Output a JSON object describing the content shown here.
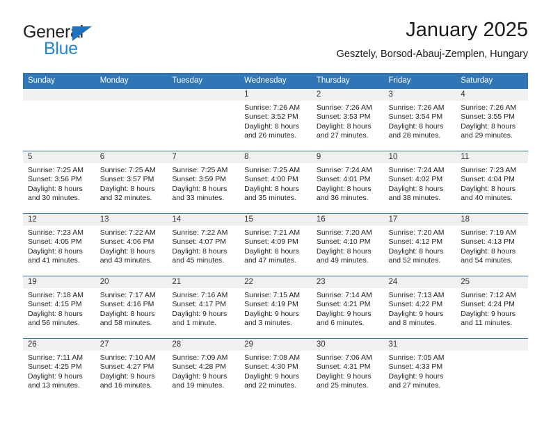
{
  "brand": {
    "name_part1": "General",
    "name_part2": "Blue",
    "triangle_icon": "triangle-icon"
  },
  "header": {
    "title": "January 2025",
    "subtitle": "Gesztely, Borsod-Abauj-Zemplen, Hungary"
  },
  "colors": {
    "header_blue": "#3075b5",
    "brand_blue": "#1f86d6",
    "daynum_band": "#f0f0f0",
    "text": "#222222"
  },
  "calendar": {
    "weekday_headers": [
      "Sunday",
      "Monday",
      "Tuesday",
      "Wednesday",
      "Thursday",
      "Friday",
      "Saturday"
    ],
    "weeks": [
      [
        {
          "day": "",
          "sunrise": "",
          "sunset": "",
          "daylight_line1": "",
          "daylight_line2": ""
        },
        {
          "day": "",
          "sunrise": "",
          "sunset": "",
          "daylight_line1": "",
          "daylight_line2": ""
        },
        {
          "day": "",
          "sunrise": "",
          "sunset": "",
          "daylight_line1": "",
          "daylight_line2": ""
        },
        {
          "day": "1",
          "sunrise": "Sunrise: 7:26 AM",
          "sunset": "Sunset: 3:52 PM",
          "daylight_line1": "Daylight: 8 hours",
          "daylight_line2": "and 26 minutes."
        },
        {
          "day": "2",
          "sunrise": "Sunrise: 7:26 AM",
          "sunset": "Sunset: 3:53 PM",
          "daylight_line1": "Daylight: 8 hours",
          "daylight_line2": "and 27 minutes."
        },
        {
          "day": "3",
          "sunrise": "Sunrise: 7:26 AM",
          "sunset": "Sunset: 3:54 PM",
          "daylight_line1": "Daylight: 8 hours",
          "daylight_line2": "and 28 minutes."
        },
        {
          "day": "4",
          "sunrise": "Sunrise: 7:26 AM",
          "sunset": "Sunset: 3:55 PM",
          "daylight_line1": "Daylight: 8 hours",
          "daylight_line2": "and 29 minutes."
        }
      ],
      [
        {
          "day": "5",
          "sunrise": "Sunrise: 7:25 AM",
          "sunset": "Sunset: 3:56 PM",
          "daylight_line1": "Daylight: 8 hours",
          "daylight_line2": "and 30 minutes."
        },
        {
          "day": "6",
          "sunrise": "Sunrise: 7:25 AM",
          "sunset": "Sunset: 3:57 PM",
          "daylight_line1": "Daylight: 8 hours",
          "daylight_line2": "and 32 minutes."
        },
        {
          "day": "7",
          "sunrise": "Sunrise: 7:25 AM",
          "sunset": "Sunset: 3:59 PM",
          "daylight_line1": "Daylight: 8 hours",
          "daylight_line2": "and 33 minutes."
        },
        {
          "day": "8",
          "sunrise": "Sunrise: 7:25 AM",
          "sunset": "Sunset: 4:00 PM",
          "daylight_line1": "Daylight: 8 hours",
          "daylight_line2": "and 35 minutes."
        },
        {
          "day": "9",
          "sunrise": "Sunrise: 7:24 AM",
          "sunset": "Sunset: 4:01 PM",
          "daylight_line1": "Daylight: 8 hours",
          "daylight_line2": "and 36 minutes."
        },
        {
          "day": "10",
          "sunrise": "Sunrise: 7:24 AM",
          "sunset": "Sunset: 4:02 PM",
          "daylight_line1": "Daylight: 8 hours",
          "daylight_line2": "and 38 minutes."
        },
        {
          "day": "11",
          "sunrise": "Sunrise: 7:23 AM",
          "sunset": "Sunset: 4:04 PM",
          "daylight_line1": "Daylight: 8 hours",
          "daylight_line2": "and 40 minutes."
        }
      ],
      [
        {
          "day": "12",
          "sunrise": "Sunrise: 7:23 AM",
          "sunset": "Sunset: 4:05 PM",
          "daylight_line1": "Daylight: 8 hours",
          "daylight_line2": "and 41 minutes."
        },
        {
          "day": "13",
          "sunrise": "Sunrise: 7:22 AM",
          "sunset": "Sunset: 4:06 PM",
          "daylight_line1": "Daylight: 8 hours",
          "daylight_line2": "and 43 minutes."
        },
        {
          "day": "14",
          "sunrise": "Sunrise: 7:22 AM",
          "sunset": "Sunset: 4:07 PM",
          "daylight_line1": "Daylight: 8 hours",
          "daylight_line2": "and 45 minutes."
        },
        {
          "day": "15",
          "sunrise": "Sunrise: 7:21 AM",
          "sunset": "Sunset: 4:09 PM",
          "daylight_line1": "Daylight: 8 hours",
          "daylight_line2": "and 47 minutes."
        },
        {
          "day": "16",
          "sunrise": "Sunrise: 7:20 AM",
          "sunset": "Sunset: 4:10 PM",
          "daylight_line1": "Daylight: 8 hours",
          "daylight_line2": "and 49 minutes."
        },
        {
          "day": "17",
          "sunrise": "Sunrise: 7:20 AM",
          "sunset": "Sunset: 4:12 PM",
          "daylight_line1": "Daylight: 8 hours",
          "daylight_line2": "and 52 minutes."
        },
        {
          "day": "18",
          "sunrise": "Sunrise: 7:19 AM",
          "sunset": "Sunset: 4:13 PM",
          "daylight_line1": "Daylight: 8 hours",
          "daylight_line2": "and 54 minutes."
        }
      ],
      [
        {
          "day": "19",
          "sunrise": "Sunrise: 7:18 AM",
          "sunset": "Sunset: 4:15 PM",
          "daylight_line1": "Daylight: 8 hours",
          "daylight_line2": "and 56 minutes."
        },
        {
          "day": "20",
          "sunrise": "Sunrise: 7:17 AM",
          "sunset": "Sunset: 4:16 PM",
          "daylight_line1": "Daylight: 8 hours",
          "daylight_line2": "and 58 minutes."
        },
        {
          "day": "21",
          "sunrise": "Sunrise: 7:16 AM",
          "sunset": "Sunset: 4:17 PM",
          "daylight_line1": "Daylight: 9 hours",
          "daylight_line2": "and 1 minute."
        },
        {
          "day": "22",
          "sunrise": "Sunrise: 7:15 AM",
          "sunset": "Sunset: 4:19 PM",
          "daylight_line1": "Daylight: 9 hours",
          "daylight_line2": "and 3 minutes."
        },
        {
          "day": "23",
          "sunrise": "Sunrise: 7:14 AM",
          "sunset": "Sunset: 4:21 PM",
          "daylight_line1": "Daylight: 9 hours",
          "daylight_line2": "and 6 minutes."
        },
        {
          "day": "24",
          "sunrise": "Sunrise: 7:13 AM",
          "sunset": "Sunset: 4:22 PM",
          "daylight_line1": "Daylight: 9 hours",
          "daylight_line2": "and 8 minutes."
        },
        {
          "day": "25",
          "sunrise": "Sunrise: 7:12 AM",
          "sunset": "Sunset: 4:24 PM",
          "daylight_line1": "Daylight: 9 hours",
          "daylight_line2": "and 11 minutes."
        }
      ],
      [
        {
          "day": "26",
          "sunrise": "Sunrise: 7:11 AM",
          "sunset": "Sunset: 4:25 PM",
          "daylight_line1": "Daylight: 9 hours",
          "daylight_line2": "and 13 minutes."
        },
        {
          "day": "27",
          "sunrise": "Sunrise: 7:10 AM",
          "sunset": "Sunset: 4:27 PM",
          "daylight_line1": "Daylight: 9 hours",
          "daylight_line2": "and 16 minutes."
        },
        {
          "day": "28",
          "sunrise": "Sunrise: 7:09 AM",
          "sunset": "Sunset: 4:28 PM",
          "daylight_line1": "Daylight: 9 hours",
          "daylight_line2": "and 19 minutes."
        },
        {
          "day": "29",
          "sunrise": "Sunrise: 7:08 AM",
          "sunset": "Sunset: 4:30 PM",
          "daylight_line1": "Daylight: 9 hours",
          "daylight_line2": "and 22 minutes."
        },
        {
          "day": "30",
          "sunrise": "Sunrise: 7:06 AM",
          "sunset": "Sunset: 4:31 PM",
          "daylight_line1": "Daylight: 9 hours",
          "daylight_line2": "and 25 minutes."
        },
        {
          "day": "31",
          "sunrise": "Sunrise: 7:05 AM",
          "sunset": "Sunset: 4:33 PM",
          "daylight_line1": "Daylight: 9 hours",
          "daylight_line2": "and 27 minutes."
        },
        {
          "day": "",
          "sunrise": "",
          "sunset": "",
          "daylight_line1": "",
          "daylight_line2": ""
        }
      ]
    ]
  }
}
